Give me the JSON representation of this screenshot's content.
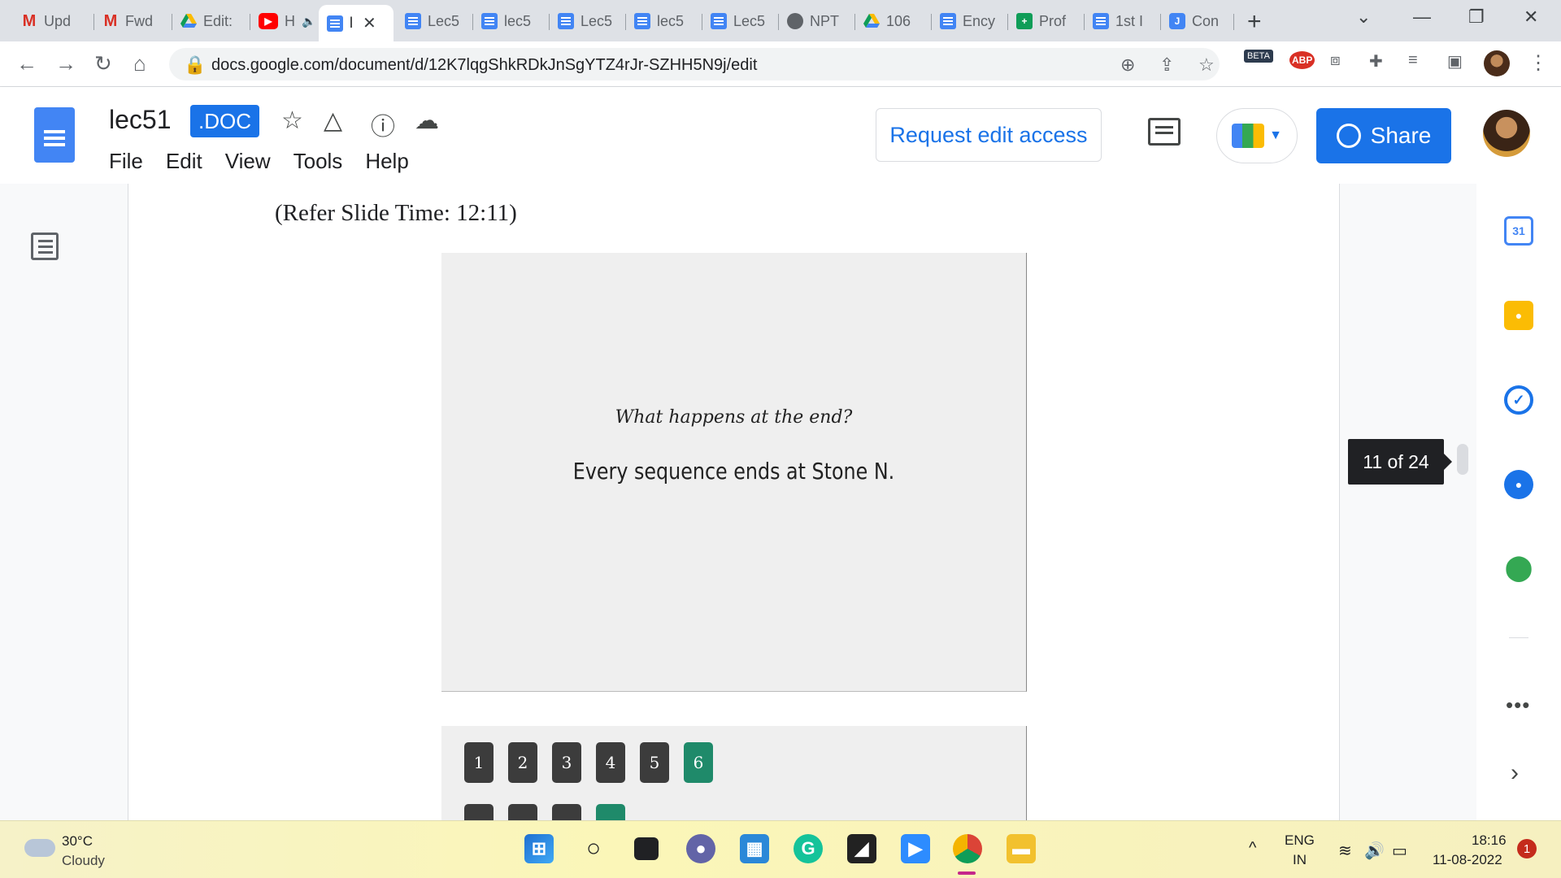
{
  "browser": {
    "tabs": [
      {
        "title": "Upd",
        "icon": "gmail-icon"
      },
      {
        "title": "Fwd",
        "icon": "gmail-icon"
      },
      {
        "title": "Edit:",
        "icon": "drive-icon"
      },
      {
        "title": "H",
        "icon": "youtube-icon",
        "audio": "speaker-icon"
      },
      {
        "title": "l",
        "icon": "docs-icon",
        "active": true
      },
      {
        "title": "Lec5",
        "icon": "docs-icon"
      },
      {
        "title": "lec5",
        "icon": "docs-icon"
      },
      {
        "title": "Lec5",
        "icon": "docs-icon"
      },
      {
        "title": "lec5",
        "icon": "docs-icon"
      },
      {
        "title": "Lec5",
        "icon": "docs-icon"
      },
      {
        "title": "NPT",
        "icon": "globe-icon"
      },
      {
        "title": "106",
        "icon": "drive-icon"
      },
      {
        "title": "Ency",
        "icon": "docs-icon"
      },
      {
        "title": "Prof",
        "icon": "sheets-icon"
      },
      {
        "title": "1st I",
        "icon": "docs-icon"
      },
      {
        "title": "Con",
        "icon": "j-icon"
      }
    ],
    "new_tab_label": "+",
    "url": "docs.google.com/document/d/12K7lqgShkRDkJnSgYTZ4rJr-SZHH5N9j/edit",
    "extensions": {
      "beta_label": "BETA",
      "abp_label": "ABP"
    }
  },
  "docs": {
    "title": "lec51",
    "badge": ".DOC",
    "menu": [
      "File",
      "Edit",
      "View",
      "Tools",
      "Help"
    ],
    "request_edit_label": "Request edit access",
    "share_label": "Share",
    "page_indicator": "11 of 24"
  },
  "document": {
    "slide_time": "(Refer Slide Time: 12:11)",
    "slide": {
      "question": "What happens at the end?",
      "answer": "Every sequence ends at Stone N."
    },
    "stones": [
      "1",
      "2",
      "3",
      "4",
      "5",
      "6"
    ],
    "highlighted_stone": "6"
  },
  "side_panel": {
    "calendar_day": "31"
  },
  "taskbar": {
    "weather_temp": "30°C",
    "weather_desc": "Cloudy",
    "lang_line1": "ENG",
    "lang_line2": "IN",
    "time": "18:16",
    "date": "11-08-2022",
    "notifications": "1"
  },
  "colors": {
    "accent": "#1a73e8",
    "stone_dark": "#3c3c3c",
    "stone_highlight": "#1f8a6a",
    "tab_strip": "#dee1e6"
  }
}
